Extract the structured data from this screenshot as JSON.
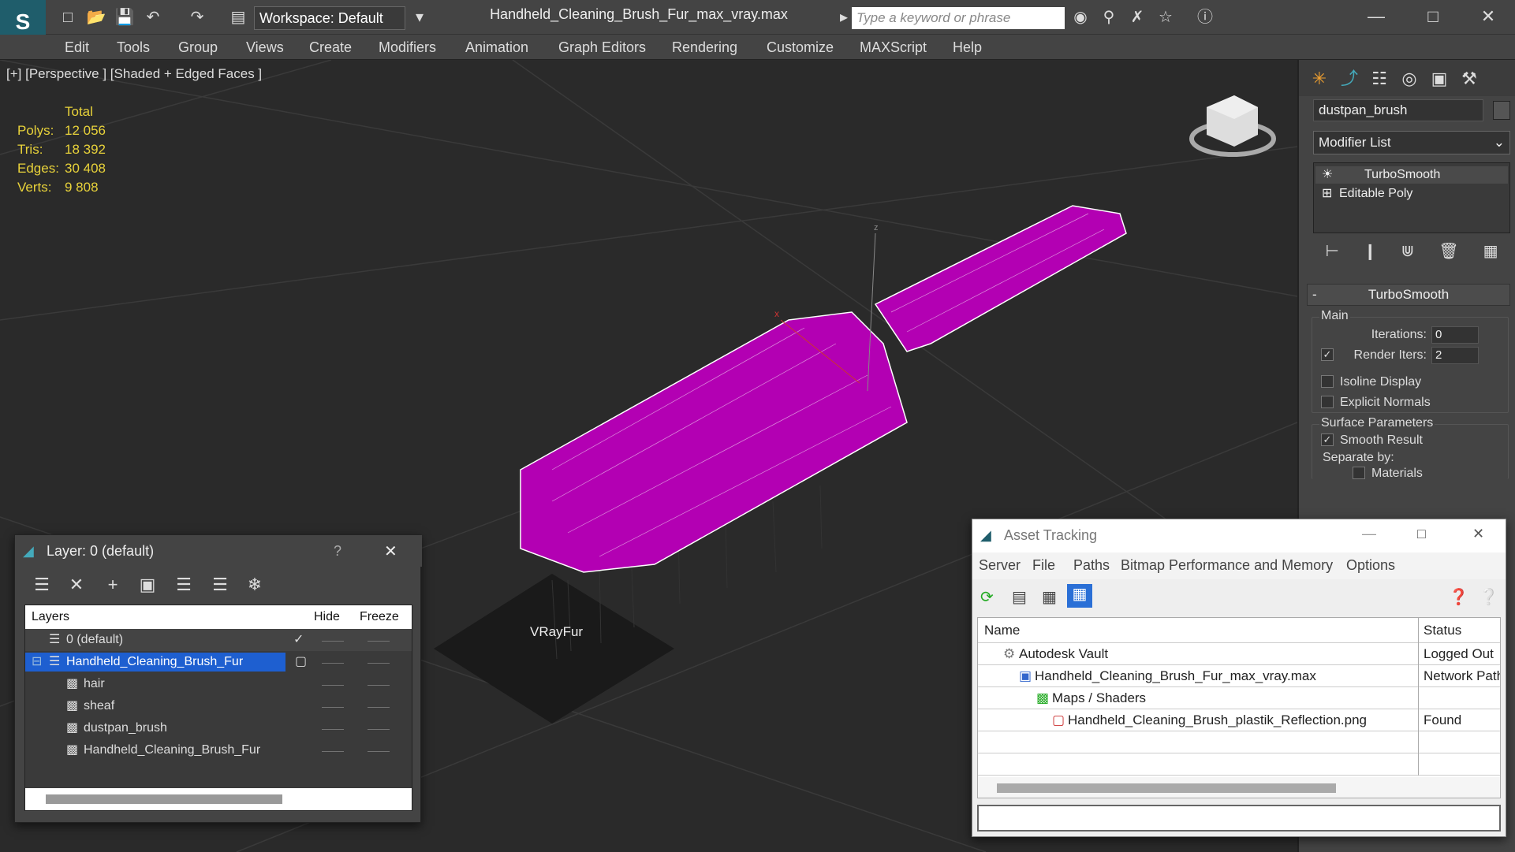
{
  "titlebar": {
    "workspace": "Workspace: Default",
    "file_title": "Handheld_Cleaning_Brush_Fur_max_vray.max",
    "search_placeholder": "Type a keyword or phrase"
  },
  "menu": [
    "Edit",
    "Tools",
    "Group",
    "Views",
    "Create",
    "Modifiers",
    "Animation",
    "Graph Editors",
    "Rendering",
    "Customize",
    "MAXScript",
    "Help"
  ],
  "viewport": {
    "label": "[+] [Perspective ] [Shaded + Edged Faces ]",
    "stats_header": "Total",
    "stats": [
      {
        "k": "Polys:",
        "v": "12 056"
      },
      {
        "k": "Tris:",
        "v": "18 392"
      },
      {
        "k": "Edges:",
        "v": "30 408"
      },
      {
        "k": "Verts:",
        "v": "9 808"
      }
    ],
    "object_label": "VRayFur",
    "axis_z": "z",
    "axis_x": "x"
  },
  "cmdpanel": {
    "object_name": "dustpan_brush",
    "modifier_list": "Modifier List",
    "stack": [
      "TurboSmooth",
      "Editable Poly"
    ],
    "rollout_title": "TurboSmooth",
    "main_label": "Main",
    "iterations_label": "Iterations:",
    "iterations_value": "0",
    "render_iters_label": "Render Iters:",
    "render_iters_value": "2",
    "isoline": "Isoline Display",
    "explicit_normals": "Explicit Normals",
    "surface_params": "Surface Parameters",
    "smooth_result": "Smooth Result",
    "separate_by": "Separate by:",
    "materials": "Materials",
    "rollout_collapse": "-"
  },
  "layerwin": {
    "title": "Layer: 0 (default)",
    "help": "?",
    "col_layers": "Layers",
    "col_hide": "Hide",
    "col_freeze": "Freeze",
    "rows": [
      {
        "name": "0 (default)",
        "indent": 0
      },
      {
        "name": "Handheld_Cleaning_Brush_Fur",
        "indent": 0
      },
      {
        "name": "hair",
        "indent": 1
      },
      {
        "name": "sheaf",
        "indent": 1
      },
      {
        "name": "dustpan_brush",
        "indent": 1
      },
      {
        "name": "Handheld_Cleaning_Brush_Fur",
        "indent": 1
      }
    ],
    "dash": "——"
  },
  "assetwin": {
    "title": "Asset Tracking",
    "menu": [
      "Server",
      "File",
      "Paths",
      "Bitmap Performance and Memory",
      "Options"
    ],
    "col_name": "Name",
    "col_status": "Status",
    "rows": [
      {
        "name": "Autodesk Vault",
        "status": "Logged Out"
      },
      {
        "name": "Handheld_Cleaning_Brush_Fur_max_vray.max",
        "status": "Network Path"
      },
      {
        "name": "Maps / Shaders",
        "status": ""
      },
      {
        "name": "Handheld_Cleaning_Brush_plastik_Reflection.png",
        "status": "Found"
      }
    ]
  },
  "colors": {
    "accent": "#1e5fd0",
    "brush": "#b300b3",
    "stats": "#e8d23a"
  }
}
